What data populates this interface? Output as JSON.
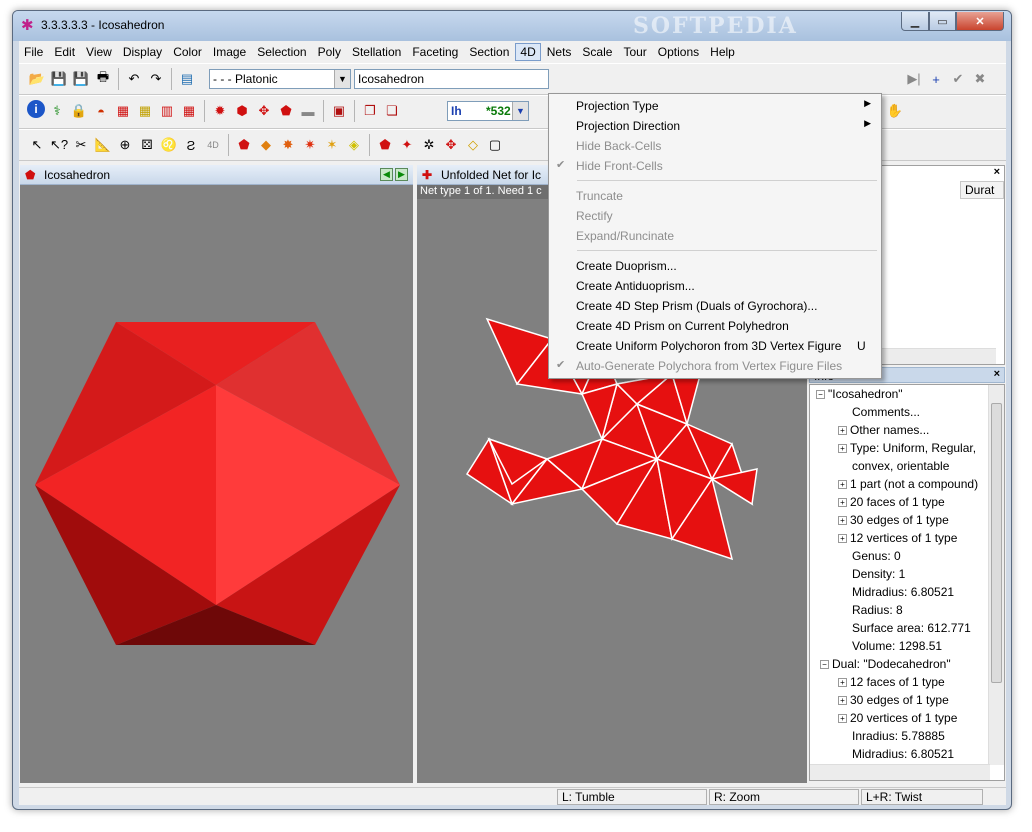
{
  "window": {
    "title": "3.3.3.3.3 - Icosahedron",
    "watermark": "SOFTPEDIA"
  },
  "menubar": [
    "File",
    "Edit",
    "View",
    "Display",
    "Color",
    "Image",
    "Selection",
    "Poly",
    "Stellation",
    "Faceting",
    "Section",
    "4D",
    "Nets",
    "Scale",
    "Tour",
    "Options",
    "Help"
  ],
  "toolbar": {
    "category_value": "- - - Platonic",
    "polyhedron_value": "Icosahedron",
    "symmetry_value": "Ih",
    "count_value": "*532"
  },
  "left_pane": {
    "title": "Icosahedron"
  },
  "mid_pane": {
    "title": "Unfolded Net for Ic",
    "net_info": "Net type 1 of 1.  Need 1 c"
  },
  "right_panel": {
    "column_header": "Durat",
    "info_title": "Info",
    "tree": [
      "\"Icosahedron\"",
      "Comments...",
      "Other names...",
      "Type: Uniform, Regular,",
      "convex, orientable",
      "1 part (not a compound)",
      "20 faces of 1 type",
      "30 edges of 1 type",
      "12 vertices of 1 type",
      "Genus: 0",
      "Density: 1",
      "Midradius: 6.80521",
      "Radius: 8",
      "Surface area: 612.771",
      "Volume: 1298.51",
      "Dual: \"Dodecahedron\"",
      "12 faces of 1 type",
      "30 edges of 1 type",
      "20 vertices of 1 type",
      "Inradius: 5.78885",
      "Midradius: 6.80521"
    ]
  },
  "dropdown_4d": {
    "items": [
      {
        "label": "Projection Type"
      },
      {
        "label": "Projection Direction"
      },
      {
        "label": "Hide Back-Cells"
      },
      {
        "label": "Hide Front-Cells"
      },
      {
        "label": "Truncate"
      },
      {
        "label": "Rectify"
      },
      {
        "label": "Expand/Runcinate"
      },
      {
        "label": "Create Duoprism..."
      },
      {
        "label": "Create Antiduoprism..."
      },
      {
        "label": "Create 4D Step Prism (Duals of Gyrochora)..."
      },
      {
        "label": "Create 4D Prism on Current Polyhedron"
      },
      {
        "label": "Create Uniform Polychoron from 3D Vertex Figure",
        "shortcut": "U"
      },
      {
        "label": "Auto-Generate Polychora from Vertex Figure Files"
      }
    ]
  },
  "statusbar": {
    "left": "L: Tumble",
    "right": "R: Zoom",
    "both": "L+R: Twist"
  },
  "colors": {
    "face": "#e01010",
    "background": "#808080"
  }
}
